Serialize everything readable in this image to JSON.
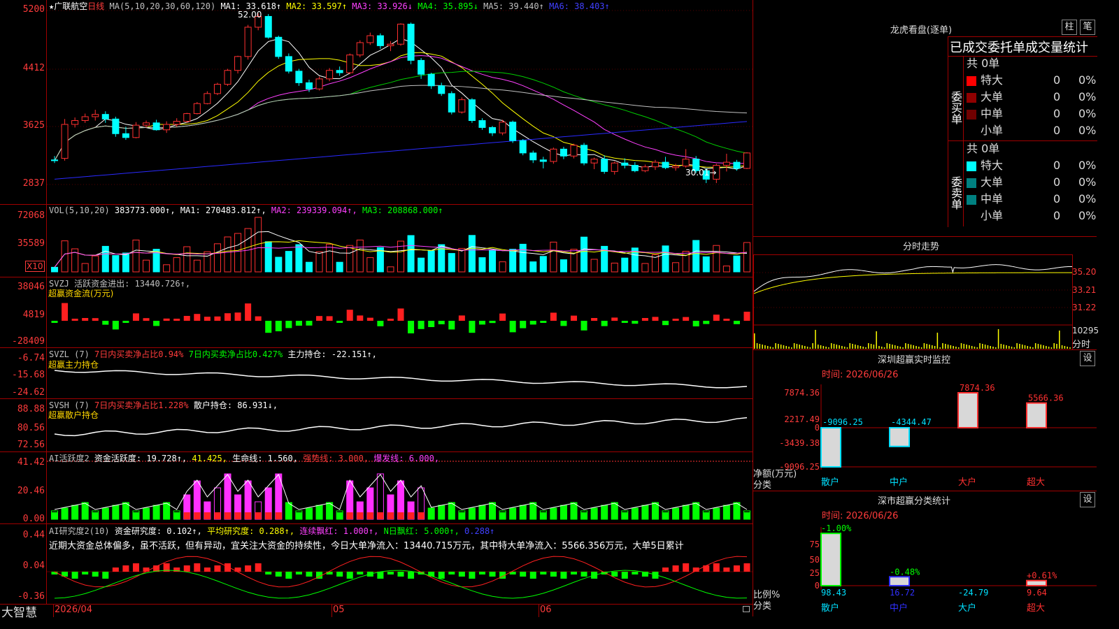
{
  "stock": {
    "star": "★",
    "name": "广联航空",
    "period": "日线"
  },
  "main_legend": {
    "ma_def": "MA(5,10,20,30,60,120)",
    "items": [
      {
        "label": "MA1: 33.618↑",
        "color": "#ffffff"
      },
      {
        "label": "MA2: 33.597↑",
        "color": "#ffff00"
      },
      {
        "label": "MA3: 33.926↓",
        "color": "#ff40ff"
      },
      {
        "label": "MA4: 35.895↓",
        "color": "#00ff00"
      },
      {
        "label": "MA5: 39.440↑",
        "color": "#c0c0c0"
      },
      {
        "label": "MA6: 38.403↑",
        "color": "#4040ff"
      }
    ],
    "high_marker": "52.00",
    "low_marker": "30.01→"
  },
  "main_y": [
    "5200",
    "4412",
    "3625",
    "2837"
  ],
  "vol": {
    "legend": [
      {
        "label": "VOL(5,10,20)",
        "color": "#c0c0c0"
      },
      {
        "label": "383773.000↑,",
        "color": "#ffffff"
      },
      {
        "label": "MA1: 270483.812↑,",
        "color": "#ffffff"
      },
      {
        "label": "MA2: 239339.094↑,",
        "color": "#ff40ff"
      },
      {
        "label": "MA3: 208868.000↑",
        "color": "#00ff00"
      }
    ],
    "y": [
      "72068",
      "35589"
    ],
    "unit": "X10"
  },
  "svzj": {
    "legend": [
      {
        "label": "SVZJ  活跃资金进出: 13440.726↑,",
        "color": "#c0c0c0"
      }
    ],
    "sub": "超赢资金流(万元)",
    "y": [
      "38046",
      "4819",
      "-28409"
    ]
  },
  "svzl": {
    "legend": [
      {
        "label": "SVZL (7)",
        "color": "#c0c0c0"
      },
      {
        "label": "7日内买卖净占比0.94%",
        "color": "#ff3b3b"
      },
      {
        "label": "7日内买卖净占比0.427%",
        "color": "#00ff00"
      },
      {
        "label": "主力持仓: -22.151↑,",
        "color": "#ffffff"
      }
    ],
    "sub": "超赢主力持仓",
    "y": [
      "-6.74",
      "-15.68",
      "-24.62"
    ]
  },
  "svsh": {
    "legend": [
      {
        "label": "SVSH (7)",
        "color": "#c0c0c0"
      },
      {
        "label": "7日内买卖净占比1.228%",
        "color": "#ff3b3b"
      },
      {
        "label": "散户持仓: 86.931↓,",
        "color": "#ffffff"
      }
    ],
    "sub": "超赢散户持仓",
    "y": [
      "88.88",
      "80.56",
      "72.56"
    ]
  },
  "ai2": {
    "legend": [
      {
        "label": "AI活跃度2",
        "color": "#c0c0c0"
      },
      {
        "label": "资金活跃度: 19.728↑,",
        "color": "#ffffff"
      },
      {
        "label": "41.425,",
        "color": "#ffff00"
      },
      {
        "label": "生命线: 1.560,",
        "color": "#ffffff"
      },
      {
        "label": "强势线: 3.000,",
        "color": "#ff3b3b"
      },
      {
        "label": "爆发线: 6.000,",
        "color": "#ff40ff"
      }
    ],
    "y": [
      "41.42",
      "20.46",
      "0.00"
    ]
  },
  "ai_study": {
    "legend": [
      {
        "label": "AI研究度2(10)",
        "color": "#c0c0c0"
      },
      {
        "label": "资金研究度: 0.102↑,",
        "color": "#ffffff"
      },
      {
        "label": "平均研究度: 0.288↑,",
        "color": "#ffff00"
      },
      {
        "label": "连续飘红: 1.000↑,",
        "color": "#ff40ff"
      },
      {
        "label": "N日飘红: 5.000↑,",
        "color": "#00ff00"
      },
      {
        "label": "0.288↑",
        "color": "#4040ff"
      }
    ],
    "text": "近期大资金总体偏多，虽不活跃，但有异动，宜关注大资金的持续性，今日大单净流入：13440.715万元，其中特大单净流入：5566.356万元，大单5日累计",
    "y": [
      "0.44",
      "0.04",
      "-0.36"
    ]
  },
  "bottom": {
    "brand": "大智慧",
    "dates": [
      "2026/04",
      "05",
      "06"
    ]
  },
  "dragon": {
    "title": "龙虎看盘(逐单)",
    "btn1": "柱",
    "btn2": "笔",
    "subtitle": "已成交委托单成交量统计",
    "buy": {
      "side_label": "委买单",
      "total": "共 0单",
      "rows": [
        {
          "name": "特大",
          "value": "0",
          "pct": "0%",
          "color": "#ff0000"
        },
        {
          "name": "大单",
          "value": "0",
          "pct": "0%",
          "color": "#900000"
        },
        {
          "name": "中单",
          "value": "0",
          "pct": "0%",
          "color": "#700000"
        },
        {
          "name": "小单",
          "value": "0",
          "pct": "0%",
          "color": ""
        }
      ]
    },
    "sell": {
      "side_label": "委卖单",
      "total": "共 0单",
      "rows": [
        {
          "name": "特大",
          "value": "0",
          "pct": "0%",
          "color": "#00ffff"
        },
        {
          "name": "大单",
          "value": "0",
          "pct": "0%",
          "color": "#008080"
        },
        {
          "name": "中单",
          "value": "0",
          "pct": "0%",
          "color": "#008080"
        },
        {
          "name": "小单",
          "value": "0",
          "pct": "0%",
          "color": ""
        }
      ]
    }
  },
  "intraday": {
    "title": "分时走势",
    "y": [
      "35.20",
      "33.21",
      "31.22"
    ],
    "vol_label": "10295",
    "fen_label": "分时"
  },
  "sz_monitor": {
    "title": "深圳超赢实时监控",
    "set_btn": "设",
    "time": "时间: 2026/06/26",
    "y": [
      "7874.36",
      "2217.49",
      "0",
      "-3439.38",
      "-9096.25"
    ],
    "ylabel": "净额(万元)",
    "xlabel": "分类",
    "bars": [
      {
        "cat": "散户",
        "value": -9096.25,
        "label": "-9096.25"
      },
      {
        "cat": "中户",
        "value": -4344.47,
        "label": "-4344.47"
      },
      {
        "cat": "大户",
        "value": 7874.36,
        "label": "7874.36"
      },
      {
        "cat": "超大",
        "value": 5566.36,
        "label": "5566.36"
      }
    ]
  },
  "sz_class": {
    "title": "深市超赢分类统计",
    "set_btn": "设",
    "time": "时间: 2026/06/26",
    "y": [
      "75",
      "50",
      "25",
      "0"
    ],
    "ylabel": "比例%",
    "xlabel": "分类",
    "bars": [
      {
        "cat": "散户",
        "top": "-1.00%",
        "bottom": "98.43",
        "value": 98.43
      },
      {
        "cat": "中户",
        "top": "-0.48%",
        "bottom": "16.72",
        "value": 16.72
      },
      {
        "cat": "大户",
        "top": "",
        "bottom": "-24.79",
        "value": -24.79
      },
      {
        "cat": "超大",
        "top": "+0.61%",
        "bottom": "9.64",
        "value": 9.64
      }
    ]
  },
  "chart_data": {
    "type": "candlestick",
    "title": "广联航空 日线",
    "ohlc_approx": [
      [
        33.0,
        33.5,
        32.6,
        32.9
      ],
      [
        33.2,
        38.3,
        32.9,
        37.6
      ],
      [
        37.6,
        38.5,
        37.2,
        38.1
      ],
      [
        38.1,
        39.0,
        37.8,
        38.6
      ],
      [
        38.6,
        39.5,
        38.1,
        38.9
      ],
      [
        38.9,
        39.3,
        37.8,
        38.3
      ],
      [
        38.3,
        38.6,
        36.0,
        36.4
      ],
      [
        36.4,
        37.3,
        35.6,
        35.9
      ],
      [
        35.9,
        37.9,
        35.8,
        37.5
      ],
      [
        37.5,
        38.1,
        37.2,
        37.8
      ],
      [
        37.8,
        38.2,
        36.8,
        36.9
      ],
      [
        36.9,
        38.0,
        36.5,
        37.6
      ],
      [
        37.6,
        38.4,
        37.3,
        38.0
      ],
      [
        38.0,
        39.1,
        37.8,
        39.0
      ],
      [
        39.0,
        40.5,
        38.9,
        40.3
      ],
      [
        40.3,
        41.9,
        40.2,
        41.6
      ],
      [
        41.6,
        43.0,
        41.4,
        42.8
      ],
      [
        42.8,
        44.8,
        42.6,
        44.6
      ],
      [
        44.6,
        46.5,
        44.2,
        46.4
      ],
      [
        46.4,
        50.5,
        46.0,
        50.2
      ],
      [
        50.2,
        52.0,
        49.8,
        51.6
      ],
      [
        51.6,
        51.9,
        48.7,
        48.9
      ],
      [
        48.9,
        49.1,
        46.1,
        46.4
      ],
      [
        46.4,
        46.8,
        44.2,
        44.5
      ],
      [
        44.5,
        44.8,
        42.6,
        43.0
      ],
      [
        43.0,
        43.4,
        41.8,
        42.2
      ],
      [
        42.2,
        43.8,
        42.0,
        43.5
      ],
      [
        43.5,
        44.9,
        43.2,
        44.6
      ],
      [
        44.6,
        45.1,
        43.9,
        44.3
      ],
      [
        44.3,
        46.8,
        44.1,
        46.6
      ],
      [
        46.6,
        48.5,
        46.3,
        48.2
      ],
      [
        48.2,
        49.5,
        47.9,
        49.1
      ],
      [
        49.1,
        49.4,
        47.4,
        47.8
      ],
      [
        47.8,
        48.4,
        47.1,
        48.0
      ],
      [
        48.0,
        50.7,
        47.8,
        50.6
      ],
      [
        50.6,
        50.8,
        45.4,
        45.9
      ],
      [
        45.9,
        46.2,
        43.5,
        44.1
      ],
      [
        44.1,
        44.3,
        42.2,
        42.6
      ],
      [
        42.6,
        43.0,
        41.3,
        41.6
      ],
      [
        41.6,
        41.9,
        38.9,
        39.2
      ],
      [
        39.2,
        41.1,
        39.0,
        40.8
      ],
      [
        40.8,
        41.0,
        37.8,
        38.1
      ],
      [
        38.1,
        38.4,
        36.9,
        37.2
      ],
      [
        37.2,
        37.4,
        36.1,
        36.5
      ],
      [
        36.5,
        38.2,
        36.2,
        37.9
      ],
      [
        37.9,
        38.1,
        35.2,
        35.5
      ],
      [
        35.5,
        35.7,
        33.6,
        33.9
      ],
      [
        33.9,
        34.2,
        32.6,
        33.0
      ],
      [
        33.0,
        33.4,
        31.9,
        32.8
      ],
      [
        32.8,
        34.6,
        32.5,
        34.4
      ],
      [
        34.4,
        34.7,
        33.1,
        33.5
      ],
      [
        33.5,
        35.1,
        33.2,
        34.9
      ],
      [
        34.9,
        35.2,
        32.3,
        32.6
      ],
      [
        32.6,
        33.3,
        31.8,
        33.1
      ],
      [
        33.1,
        33.6,
        31.2,
        31.5
      ],
      [
        31.5,
        32.8,
        31.1,
        32.6
      ],
      [
        32.6,
        33.2,
        31.9,
        32.3
      ],
      [
        32.3,
        32.7,
        31.4,
        31.6
      ],
      [
        31.6,
        32.4,
        31.4,
        32.1
      ],
      [
        32.1,
        33.0,
        31.7,
        32.7
      ],
      [
        32.7,
        33.4,
        31.8,
        32.0
      ],
      [
        32.0,
        32.5,
        31.6,
        32.2
      ],
      [
        32.2,
        34.4,
        32.0,
        33.1
      ],
      [
        33.1,
        33.5,
        31.3,
        31.6
      ],
      [
        31.6,
        31.9,
        30.0,
        30.5
      ],
      [
        30.5,
        32.5,
        30.0,
        32.3
      ],
      [
        32.3,
        33.8,
        31.5,
        32.7
      ],
      [
        32.7,
        33.0,
        31.6,
        31.9
      ],
      [
        31.9,
        34.0,
        31.8,
        33.9
      ]
    ]
  }
}
